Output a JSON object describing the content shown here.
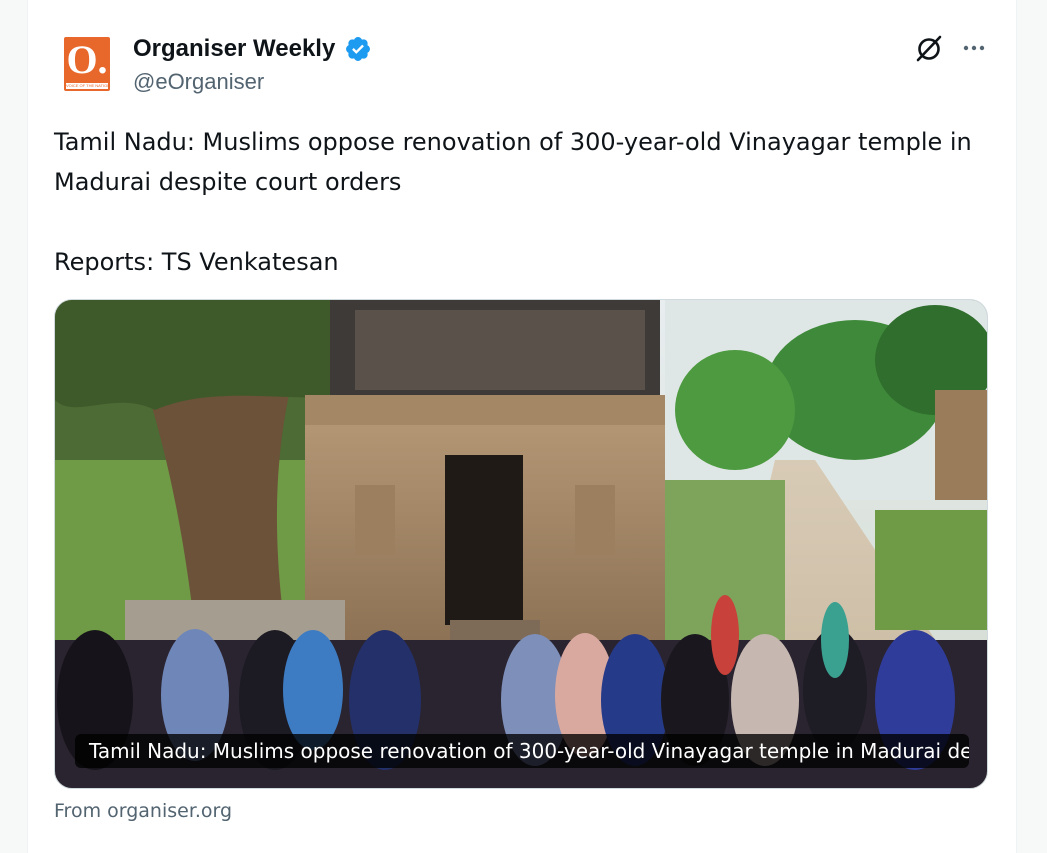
{
  "account": {
    "name": "Organiser Weekly",
    "handle": "@eOrganiser",
    "avatar_letter": "O.",
    "avatar_tagline": "VOICE OF THE NATION",
    "avatar_color": "#e8672a",
    "verified": true,
    "verified_color": "#1d9bf0"
  },
  "header_actions": {
    "grok_icon": "grok-slash-circle-icon",
    "more_icon": "ellipsis-icon"
  },
  "tweet": {
    "text_line": "Tamil Nadu: Muslims oppose renovation of 300-year-old Vinayagar temple in Madurai despite court orders",
    "reporter_line": "Reports: TS Venkatesan"
  },
  "link_card": {
    "caption": "Tamil Nadu: Muslims oppose renovation of 300-year-old Vinayagar temple in Madurai des...",
    "source": "From organiser.org"
  }
}
